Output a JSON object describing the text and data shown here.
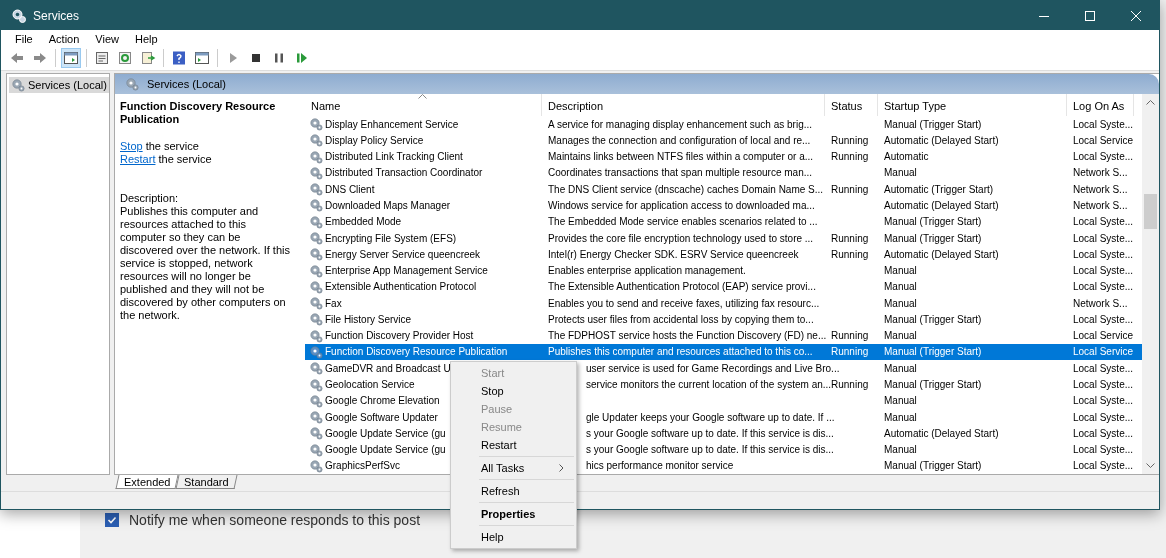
{
  "window": {
    "title": "Services"
  },
  "menu_bar": [
    "File",
    "Action",
    "View",
    "Help"
  ],
  "toolbar": [
    {
      "kind": "back",
      "selected": false
    },
    {
      "kind": "forward",
      "selected": false
    },
    {
      "kind": "separator"
    },
    {
      "kind": "tree",
      "selected": true
    },
    {
      "kind": "separator"
    },
    {
      "kind": "properties",
      "selected": false
    },
    {
      "kind": "refresh",
      "selected": false
    },
    {
      "kind": "export",
      "selected": false
    },
    {
      "kind": "separator"
    },
    {
      "kind": "help",
      "selected": false
    },
    {
      "kind": "console",
      "selected": false
    },
    {
      "kind": "separator"
    },
    {
      "kind": "play",
      "selected": false
    },
    {
      "kind": "stop",
      "selected": false
    },
    {
      "kind": "pause",
      "selected": false
    },
    {
      "kind": "resume",
      "selected": false
    }
  ],
  "tree": [
    {
      "label": "Services (Local)",
      "selected": true
    }
  ],
  "panel_header": "Services (Local)",
  "details": {
    "title": "Function Discovery Resource Publication",
    "actions": [
      {
        "link": "Stop",
        "text": "the service"
      },
      {
        "link": "Restart",
        "text": "the service"
      }
    ],
    "description_label": "Description:",
    "description": "Publishes this computer and resources attached to this computer so they can be discovered over the network.  If this service is stopped, network resources will no longer be published and they will not be discovered by other computers on the network."
  },
  "table": {
    "columns": [
      "Name",
      "Description",
      "Status",
      "Startup Type",
      "Log On As"
    ],
    "rows": [
      {
        "name": "Display Enhancement Service",
        "description": "A service for managing display enhancement such as brig...",
        "status": "",
        "startup": "Manual (Trigger Start)",
        "log_on_as": "Local Syste...",
        "selected": false
      },
      {
        "name": "Display Policy Service",
        "description": "Manages the connection and configuration of local and re...",
        "status": "Running",
        "startup": "Automatic (Delayed Start)",
        "log_on_as": "Local Service",
        "selected": false
      },
      {
        "name": "Distributed Link Tracking Client",
        "description": "Maintains links between NTFS files within a computer or a...",
        "status": "Running",
        "startup": "Automatic",
        "log_on_as": "Local Syste...",
        "selected": false
      },
      {
        "name": "Distributed Transaction Coordinator",
        "description": "Coordinates transactions that span multiple resource man...",
        "status": "",
        "startup": "Manual",
        "log_on_as": "Network S...",
        "selected": false
      },
      {
        "name": "DNS Client",
        "description": "The DNS Client service (dnscache) caches Domain Name S...",
        "status": "Running",
        "startup": "Automatic (Trigger Start)",
        "log_on_as": "Network S...",
        "selected": false
      },
      {
        "name": "Downloaded Maps Manager",
        "description": "Windows service for application access to downloaded ma...",
        "status": "",
        "startup": "Automatic (Delayed Start)",
        "log_on_as": "Network S...",
        "selected": false
      },
      {
        "name": "Embedded Mode",
        "description": "The Embedded Mode service enables scenarios related to ...",
        "status": "",
        "startup": "Manual (Trigger Start)",
        "log_on_as": "Local Syste...",
        "selected": false
      },
      {
        "name": "Encrypting File System (EFS)",
        "description": "Provides the core file encryption technology used to store ...",
        "status": "Running",
        "startup": "Manual (Trigger Start)",
        "log_on_as": "Local Syste...",
        "selected": false
      },
      {
        "name": "Energy Server Service queencreek",
        "description": "Intel(r) Energy Checker SDK. ESRV Service queencreek",
        "status": "Running",
        "startup": "Automatic (Delayed Start)",
        "log_on_as": "Local Syste...",
        "selected": false
      },
      {
        "name": "Enterprise App Management Service",
        "description": "Enables enterprise application management.",
        "status": "",
        "startup": "Manual",
        "log_on_as": "Local Syste...",
        "selected": false
      },
      {
        "name": "Extensible Authentication Protocol",
        "description": "The Extensible Authentication Protocol (EAP) service provi...",
        "status": "",
        "startup": "Manual",
        "log_on_as": "Local Syste...",
        "selected": false
      },
      {
        "name": "Fax",
        "description": "Enables you to send and receive faxes, utilizing fax resourc...",
        "status": "",
        "startup": "Manual",
        "log_on_as": "Network S...",
        "selected": false
      },
      {
        "name": "File History Service",
        "description": "Protects user files from accidental loss by copying them to...",
        "status": "",
        "startup": "Manual (Trigger Start)",
        "log_on_as": "Local Syste...",
        "selected": false
      },
      {
        "name": "Function Discovery Provider Host",
        "description": "The FDPHOST service hosts the Function Discovery (FD) ne...",
        "status": "Running",
        "startup": "Manual",
        "log_on_as": "Local Service",
        "selected": false
      },
      {
        "name": "Function Discovery Resource Publication",
        "description": "Publishes this computer and resources attached to this co...",
        "status": "Running",
        "startup": "Manual (Trigger Start)",
        "log_on_as": "Local Service",
        "selected": true
      },
      {
        "name": "GameDVR and Broadcast U",
        "description": "user service is used for Game Recordings and Live Bro...",
        "status": "",
        "startup": "Manual",
        "log_on_as": "Local Syste...",
        "selected": false
      },
      {
        "name": "Geolocation Service",
        "description": "service monitors the current location of the system an...",
        "status": "Running",
        "startup": "Manual (Trigger Start)",
        "log_on_as": "Local Syste...",
        "selected": false
      },
      {
        "name": "Google Chrome Elevation",
        "description": "",
        "status": "",
        "startup": "Manual",
        "log_on_as": "Local Syste...",
        "selected": false
      },
      {
        "name": "Google Software Updater",
        "description": "gle Updater keeps your Google software up to date. If ...",
        "status": "",
        "startup": "Manual",
        "log_on_as": "Local Syste...",
        "selected": false
      },
      {
        "name": "Google Update Service (gu",
        "description": "s your Google software up to date. If this service is dis...",
        "status": "",
        "startup": "Automatic (Delayed Start)",
        "log_on_as": "Local Syste...",
        "selected": false
      },
      {
        "name": "Google Update Service (gu",
        "description": "s your Google software up to date. If this service is dis...",
        "status": "",
        "startup": "Manual",
        "log_on_as": "Local Syste...",
        "selected": false
      },
      {
        "name": "GraphicsPerfSvc",
        "description": "hics performance monitor service",
        "status": "",
        "startup": "Manual (Trigger Start)",
        "log_on_as": "Local Syste...",
        "selected": false
      }
    ]
  },
  "context_menu": [
    {
      "kind": "item",
      "label": "Start",
      "disabled": true,
      "default": false
    },
    {
      "kind": "item",
      "label": "Stop",
      "disabled": false,
      "default": false
    },
    {
      "kind": "item",
      "label": "Pause",
      "disabled": true,
      "default": false
    },
    {
      "kind": "item",
      "label": "Resume",
      "disabled": true,
      "default": false
    },
    {
      "kind": "item",
      "label": "Restart",
      "disabled": false,
      "default": false
    },
    {
      "kind": "separator"
    },
    {
      "kind": "submenu",
      "label": "All Tasks",
      "disabled": false,
      "default": false
    },
    {
      "kind": "separator"
    },
    {
      "kind": "item",
      "label": "Refresh",
      "disabled": false,
      "default": false
    },
    {
      "kind": "separator"
    },
    {
      "kind": "item",
      "label": "Properties",
      "disabled": false,
      "default": true
    },
    {
      "kind": "separator"
    },
    {
      "kind": "item",
      "label": "Help",
      "disabled": false,
      "default": false
    }
  ],
  "view_tabs": [
    {
      "label": "Extended",
      "selected": true
    },
    {
      "label": "Standard",
      "selected": false
    }
  ],
  "background_page": {
    "checkbox": {
      "label": "Notify me when someone responds to this post",
      "checked": true
    }
  }
}
